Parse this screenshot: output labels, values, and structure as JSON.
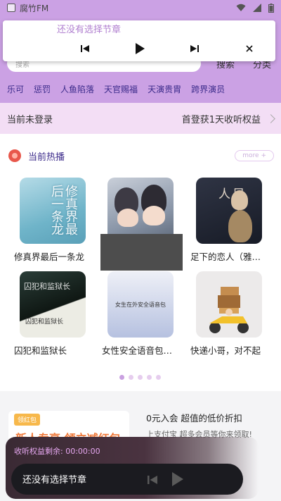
{
  "status_bar": {
    "app_name": "腐竹FM"
  },
  "top_player": {
    "title": "还没有选择节章"
  },
  "search": {
    "placeholder": "搜索",
    "search_label": "搜索",
    "category_label": "分类"
  },
  "tags": [
    "乐可",
    "惩罚",
    "人鱼陷落",
    "天官赐福",
    "天演贵胄",
    "跨界演员"
  ],
  "login": {
    "status": "当前未登录",
    "promo": "首登获1天收听权益"
  },
  "hot": {
    "title": "当前热播",
    "more": "more +",
    "items": [
      {
        "title": "修真界最后一条龙",
        "cover_text": "修真界最后一条龙"
      },
      {
        "title": "",
        "cover_text": ""
      },
      {
        "title": "足下的恋人（雅策...",
        "cover_text": "足下的恋人"
      },
      {
        "title": "囚犯和监狱长",
        "cover_text": "囚犯和监狱长"
      },
      {
        "title": "女性安全语音包（...",
        "cover_text": "女生在外安全语音包"
      },
      {
        "title": "快递小哥，对不起",
        "cover_text": ""
      }
    ]
  },
  "promo": {
    "tag": "领红包",
    "big_text": "新人专享 领立减红包",
    "right_title": "0元入会 超值的低价折扣",
    "right_sub": "上支付宝 超多会员等你来领取!"
  },
  "bottom_player": {
    "remaining": "收听权益剩余: 00:00:00",
    "title": "还没有选择节章"
  },
  "colors": {
    "accent": "#cba1e4",
    "tag_text": "#3b2a8a",
    "strip": "#f3def5"
  }
}
